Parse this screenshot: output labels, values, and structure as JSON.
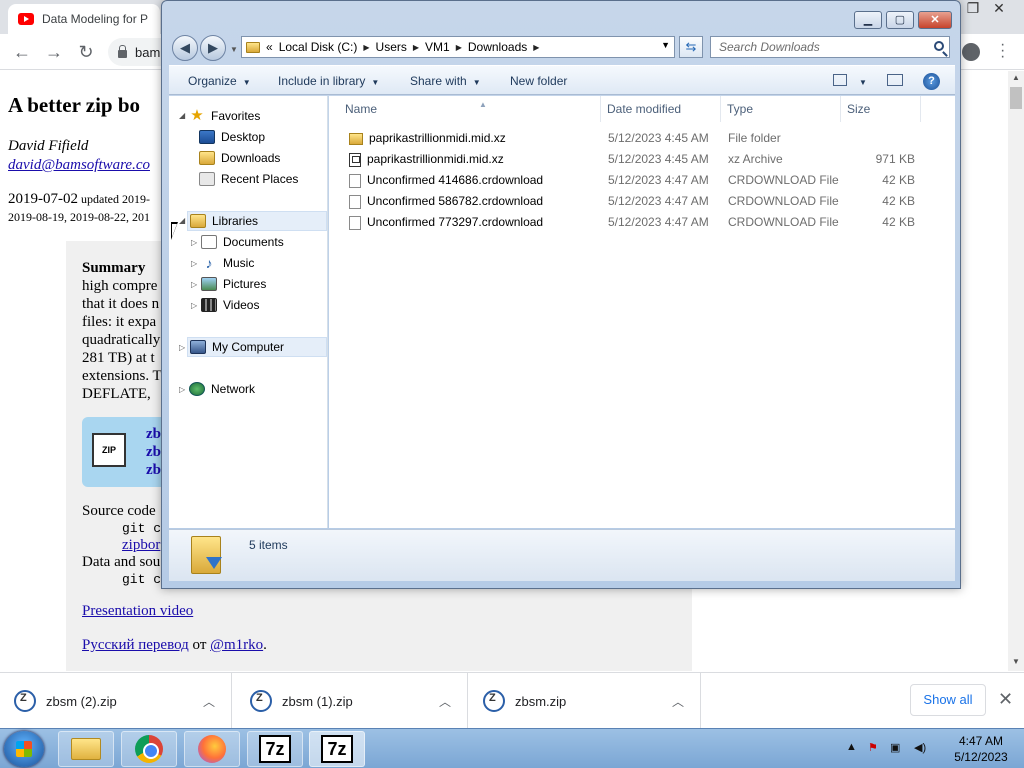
{
  "browser": {
    "tab_title": "Data Modeling for P",
    "url_fragment": "bam",
    "min": "—",
    "max": "❐",
    "close": "✕"
  },
  "page": {
    "heading": "A better zip bo",
    "author": "David Fifield",
    "email": "david@bamsoftware.co",
    "date_line1_main": "2019-07-02",
    "date_line1_small": " updated 2019-",
    "date_line2": "2019-08-19, 2019-08-22, 201",
    "summary_bold": "Summary",
    "summary_lines": [
      "high compre",
      "that it does n",
      "files: it expa",
      "quadratically",
      "281 TB) at t",
      "extensions. T",
      "DEFLATE, "
    ],
    "dl_links": [
      "zb",
      "zb",
      "zb"
    ],
    "zip_icon_text": "ZIP",
    "source_label": "Source code",
    "source_cmd": "git cl",
    "source_link": "zipbor",
    "data_label": "Data and sou",
    "data_cmd": "git cl",
    "presentation": "Presentation video",
    "russian_link": "Русский перевод",
    "russian_from": " от ",
    "russian_author": "@m1rko",
    "russian_tail": "."
  },
  "downloads": {
    "items": [
      "zbsm (2).zip",
      "zbsm (1).zip",
      "zbsm.zip"
    ],
    "show_all": "Show all"
  },
  "explorer": {
    "breadcrumbs": [
      "«",
      "Local Disk (C:)",
      "Users",
      "VM1",
      "Downloads"
    ],
    "search_placeholder": "Search Downloads",
    "commands": {
      "organize": "Organize",
      "include": "Include in library",
      "share": "Share with",
      "new_folder": "New folder"
    },
    "nav": {
      "favorites": "Favorites",
      "desktop": "Desktop",
      "downloads": "Downloads",
      "recent": "Recent Places",
      "libraries": "Libraries",
      "documents": "Documents",
      "music": "Music",
      "pictures": "Pictures",
      "videos": "Videos",
      "my_computer": "My Computer",
      "network": "Network"
    },
    "columns": {
      "name": "Name",
      "date": "Date modified",
      "type": "Type",
      "size": "Size"
    },
    "files": [
      {
        "name": "paprikastrillionmidi.mid.xz",
        "date": "5/12/2023 4:45 AM",
        "type": "File folder",
        "size": "",
        "icon": "folder-icon"
      },
      {
        "name": "paprikastrillionmidi.mid.xz",
        "date": "5/12/2023 4:45 AM",
        "type": "xz Archive",
        "size": "971 KB",
        "icon": "archive-icon"
      },
      {
        "name": "Unconfirmed 414686.crdownload",
        "date": "5/12/2023 4:47 AM",
        "type": "CRDOWNLOAD File",
        "size": "42 KB",
        "icon": "file-icon"
      },
      {
        "name": "Unconfirmed 586782.crdownload",
        "date": "5/12/2023 4:47 AM",
        "type": "CRDOWNLOAD File",
        "size": "42 KB",
        "icon": "file-icon"
      },
      {
        "name": "Unconfirmed 773297.crdownload",
        "date": "5/12/2023 4:47 AM",
        "type": "CRDOWNLOAD File",
        "size": "42 KB",
        "icon": "file-icon"
      }
    ],
    "item_count": "5 items"
  },
  "taskbar": {
    "sevenzip_label": "7z",
    "time": "4:47 AM",
    "date": "5/12/2023"
  }
}
